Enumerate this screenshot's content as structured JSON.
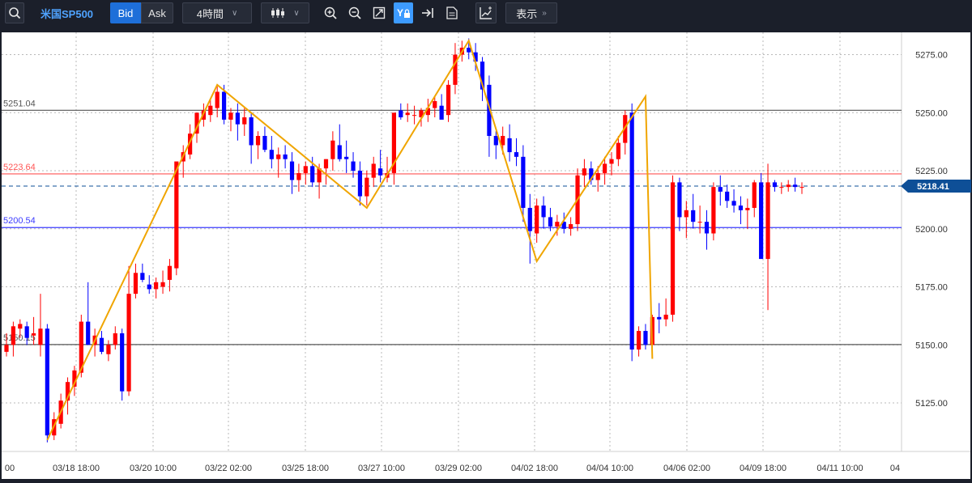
{
  "toolbar": {
    "symbol": "米国SP500",
    "bid_label": "Bid",
    "ask_label": "Ask",
    "timeframe": "4時間",
    "display_label": "表示",
    "icons": [
      "search-icon",
      "candlestick-icon",
      "zoom-in-icon",
      "zoom-out-icon",
      "fit-icon",
      "y-lock-icon",
      "scroll-end-icon",
      "document-icon",
      "add-indicator-icon"
    ]
  },
  "chart_data": {
    "type": "candlestick",
    "y_ticks": [
      "5275.00",
      "5250.00",
      "5225.00",
      "5200.00",
      "5175.00",
      "5150.00",
      "5125.00"
    ],
    "y_tick_values": [
      5275,
      5250,
      5225,
      5200,
      5175,
      5150,
      5125
    ],
    "ylim": [
      5104.1,
      5284.6
    ],
    "x_tick_labels": [
      "00",
      "03/18 18:00",
      "03/20 10:00",
      "03/22 02:00",
      "03/25 18:00",
      "03/27 10:00",
      "03/29 02:00",
      "04/02 18:00",
      "04/04 10:00",
      "04/06 02:00",
      "04/09 18:00",
      "04/11 10:00",
      "04"
    ],
    "current_price": {
      "label": "5218.41",
      "value": 5218.41,
      "color": "#0e4f97"
    },
    "horizontal_lines": [
      {
        "label": "5251.04",
        "value": 5251.04,
        "color": "#555555"
      },
      {
        "label": "5223.64",
        "value": 5223.64,
        "color": "#ff5555"
      },
      {
        "label": "5200.54",
        "value": 5200.54,
        "color": "#3b3bff"
      },
      {
        "label": "5150.15",
        "value": 5150.15,
        "color": "#555555"
      }
    ],
    "up_color": "#ff0000",
    "down_color": "#0000ff",
    "zigzag_color": "#f0a500",
    "candles": [
      [
        5147,
        5155,
        5145,
        5150
      ],
      [
        5150,
        5160,
        5145,
        5158
      ],
      [
        5157,
        5161,
        5153,
        5159
      ],
      [
        5158,
        5160,
        5150,
        5153
      ],
      [
        5154,
        5162,
        5150,
        5155
      ],
      [
        5150,
        5172,
        5145,
        5157
      ],
      [
        5157,
        5159,
        5108,
        5111
      ],
      [
        5111,
        5121,
        5109,
        5118
      ],
      [
        5116,
        5129,
        5114,
        5126
      ],
      [
        5126,
        5136,
        5120,
        5134
      ],
      [
        5132,
        5141,
        5128,
        5139
      ],
      [
        5138,
        5163,
        5136,
        5160
      ],
      [
        5160,
        5177,
        5155,
        5150
      ],
      [
        5150,
        5157,
        5145,
        5154
      ],
      [
        5153,
        5156,
        5146,
        5147
      ],
      [
        5146,
        5152,
        5143,
        5150
      ],
      [
        5150,
        5158,
        5148,
        5155
      ],
      [
        5155,
        5157,
        5126,
        5130
      ],
      [
        5130,
        5184,
        5128,
        5172
      ],
      [
        5172,
        5185,
        5170,
        5181
      ],
      [
        5181,
        5185,
        5177,
        5178
      ],
      [
        5176,
        5180,
        5172,
        5174
      ],
      [
        5174,
        5179,
        5170,
        5177
      ],
      [
        5175,
        5182,
        5172,
        5177
      ],
      [
        5178,
        5187,
        5173,
        5184
      ],
      [
        5183,
        5190,
        5180,
        5229
      ],
      [
        5229,
        5236,
        5222,
        5233
      ],
      [
        5232,
        5245,
        5230,
        5241
      ],
      [
        5241,
        5248,
        5237,
        5250
      ],
      [
        5247,
        5254,
        5244,
        5251
      ],
      [
        5249,
        5256,
        5246,
        5253
      ],
      [
        5252,
        5262,
        5248,
        5259
      ],
      [
        5259,
        5262,
        5245,
        5247
      ],
      [
        5247,
        5252,
        5242,
        5250
      ],
      [
        5250,
        5254,
        5238,
        5245
      ],
      [
        5245,
        5252,
        5240,
        5248
      ],
      [
        5248,
        5250,
        5228,
        5236
      ],
      [
        5236,
        5242,
        5230,
        5240
      ],
      [
        5240,
        5244,
        5233,
        5234
      ],
      [
        5234,
        5240,
        5226,
        5230
      ],
      [
        5230,
        5235,
        5222,
        5232
      ],
      [
        5232,
        5236,
        5226,
        5230
      ],
      [
        5229,
        5233,
        5215,
        5221
      ],
      [
        5221,
        5228,
        5216,
        5224
      ],
      [
        5224,
        5229,
        5219,
        5227
      ],
      [
        5227,
        5231,
        5218,
        5220
      ],
      [
        5220,
        5228,
        5213,
        5226
      ],
      [
        5226,
        5230,
        5219,
        5230
      ],
      [
        5230,
        5242,
        5225,
        5238
      ],
      [
        5236,
        5245,
        5229,
        5230
      ],
      [
        5231,
        5238,
        5224,
        5230
      ],
      [
        5229,
        5233,
        5222,
        5225
      ],
      [
        5225,
        5229,
        5210,
        5214
      ],
      [
        5214,
        5225,
        5210,
        5222
      ],
      [
        5222,
        5231,
        5218,
        5228
      ],
      [
        5226,
        5234,
        5220,
        5223
      ],
      [
        5222,
        5231,
        5220,
        5224
      ],
      [
        5224,
        5232,
        5219,
        5250
      ],
      [
        5251,
        5254,
        5247,
        5248
      ],
      [
        5249,
        5254,
        5246,
        5250
      ],
      [
        5249,
        5253,
        5245,
        5249
      ],
      [
        5248,
        5252,
        5244,
        5251
      ],
      [
        5249,
        5256,
        5246,
        5252
      ],
      [
        5252,
        5257,
        5248,
        5255
      ],
      [
        5253,
        5258,
        5249,
        5247
      ],
      [
        5249,
        5264,
        5246,
        5262
      ],
      [
        5262,
        5280,
        5258,
        5275
      ],
      [
        5275,
        5281,
        5272,
        5278
      ],
      [
        5278,
        5282,
        5273,
        5276
      ],
      [
        5276,
        5280,
        5268,
        5272
      ],
      [
        5272,
        5274,
        5255,
        5260
      ],
      [
        5262,
        5266,
        5231,
        5240
      ],
      [
        5240,
        5242,
        5230,
        5236
      ],
      [
        5236,
        5244,
        5232,
        5240
      ],
      [
        5239,
        5245,
        5229,
        5233
      ],
      [
        5233,
        5239,
        5227,
        5231
      ],
      [
        5231,
        5236,
        5203,
        5209
      ],
      [
        5209,
        5215,
        5185,
        5199
      ],
      [
        5198,
        5213,
        5194,
        5210
      ],
      [
        5210,
        5214,
        5200,
        5205
      ],
      [
        5205,
        5209,
        5199,
        5201
      ],
      [
        5201,
        5206,
        5197,
        5203
      ],
      [
        5203,
        5207,
        5198,
        5200
      ],
      [
        5200,
        5205,
        5197,
        5202
      ],
      [
        5202,
        5226,
        5199,
        5223
      ],
      [
        5223,
        5230,
        5218,
        5226
      ],
      [
        5226,
        5229,
        5219,
        5221
      ],
      [
        5221,
        5227,
        5216,
        5224
      ],
      [
        5224,
        5231,
        5219,
        5228
      ],
      [
        5228,
        5233,
        5223,
        5230
      ],
      [
        5230,
        5240,
        5227,
        5237
      ],
      [
        5237,
        5251,
        5232,
        5249
      ],
      [
        5250,
        5254,
        5143,
        5148
      ],
      [
        5148,
        5158,
        5145,
        5156
      ],
      [
        5156,
        5159,
        5148,
        5150
      ],
      [
        5150,
        5163,
        5147,
        5162
      ],
      [
        5162,
        5168,
        5155,
        5161
      ],
      [
        5161,
        5170,
        5158,
        5163
      ],
      [
        5163,
        5223,
        5160,
        5220
      ],
      [
        5220,
        5222,
        5199,
        5205
      ],
      [
        5205,
        5212,
        5196,
        5208
      ],
      [
        5208,
        5215,
        5200,
        5203
      ],
      [
        5203,
        5210,
        5198,
        5203
      ],
      [
        5203,
        5208,
        5191,
        5198
      ],
      [
        5198,
        5220,
        5195,
        5218
      ],
      [
        5218,
        5223,
        5210,
        5216
      ],
      [
        5216,
        5219,
        5209,
        5212
      ],
      [
        5212,
        5217,
        5207,
        5210
      ],
      [
        5210,
        5214,
        5202,
        5208
      ],
      [
        5208,
        5213,
        5200,
        5209
      ],
      [
        5209,
        5221,
        5205,
        5220
      ],
      [
        5220,
        5224,
        5190,
        5187
      ],
      [
        5187,
        5228,
        5165,
        5220
      ],
      [
        5220,
        5221,
        5216,
        5218
      ],
      [
        5218,
        5220,
        5215,
        5218
      ],
      [
        5218,
        5221,
        5216,
        5219
      ],
      [
        5219,
        5222,
        5216,
        5218
      ],
      [
        5218,
        5220,
        5215,
        5218
      ]
    ],
    "zigzag": [
      {
        "i": 6,
        "v": 5109
      },
      {
        "i": 31,
        "v": 5262
      },
      {
        "i": 53,
        "v": 5209
      },
      {
        "i": 68,
        "v": 5281
      },
      {
        "i": 78,
        "v": 5186
      },
      {
        "i": 94,
        "v": 5257
      },
      {
        "i": 95,
        "v": 5144
      }
    ]
  }
}
